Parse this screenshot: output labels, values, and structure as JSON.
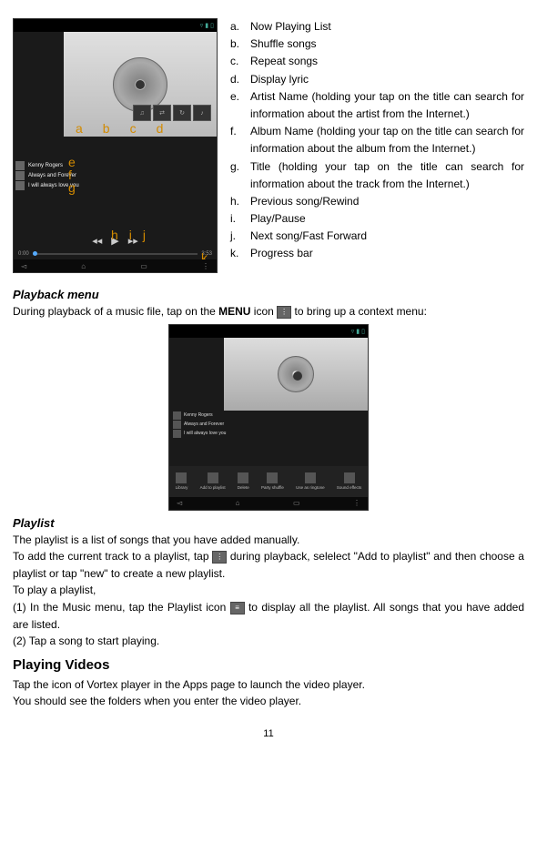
{
  "legend": {
    "a": "Now Playing List",
    "b": "Shuffle songs",
    "c": "Repeat songs",
    "d": "Display lyric",
    "e": "Artist Name (holding your tap on the title can search for information about the artist from the Internet.)",
    "f": "Album Name (holding your tap on the title can search for information about the album from the Internet.)",
    "g": "Title (holding your tap on the title can search for information about the track from the Internet.)",
    "h": "Previous song/Rewind",
    "i": "Play/Pause",
    "j": "Next song/Fast Forward",
    "k": "Progress bar"
  },
  "screenshot1": {
    "sidebar": [
      "Kenny Rogers",
      "Always and Forever",
      "I will always love you"
    ],
    "time_left": "0:00",
    "time_right": "3:53",
    "labels": {
      "a": "a",
      "b": "b",
      "c": "c",
      "d": "d",
      "e": "e",
      "f": "f",
      "g": "g",
      "h": "h",
      "i": "i",
      "j": "j",
      "k": "k"
    }
  },
  "screenshot2": {
    "sidebar": [
      "Kenny Rogers",
      "Always and Forever",
      "I will always love you"
    ],
    "menu": [
      "Library",
      "Add to playlist",
      "Delete",
      "Party shuffle",
      "Use as ringtone",
      "Sound effects"
    ]
  },
  "sections": {
    "playback_menu_title": "Playback menu",
    "playback_menu_text_1": "During playback of a music file, tap on the ",
    "playback_menu_bold": "MENU",
    "playback_menu_text_2": " icon ",
    "playback_menu_text_3": " to bring up a context menu:",
    "playlist_title": "Playlist",
    "playlist_p1": "The playlist is a list of songs that you have added manually.",
    "playlist_p2a": "To add the current track to a playlist, tap ",
    "playlist_p2b": " during playback, selelect \"Add to playlist\" and then choose a playlist or tap \"new\" to create a new playlist.",
    "playlist_p3": "To play a playlist,",
    "playlist_s1a": "(1) In the Music menu, tap the Playlist icon ",
    "playlist_s1b": " to display all the playlist. All songs that you have added are listed.",
    "playlist_s2": "(2) Tap a song to start playing.",
    "videos_title": "Playing Videos",
    "videos_p1": "Tap the icon of Vortex player in the Apps page to launch the video player.",
    "videos_p2": "You should see the folders when you enter the video player."
  },
  "page": "11"
}
